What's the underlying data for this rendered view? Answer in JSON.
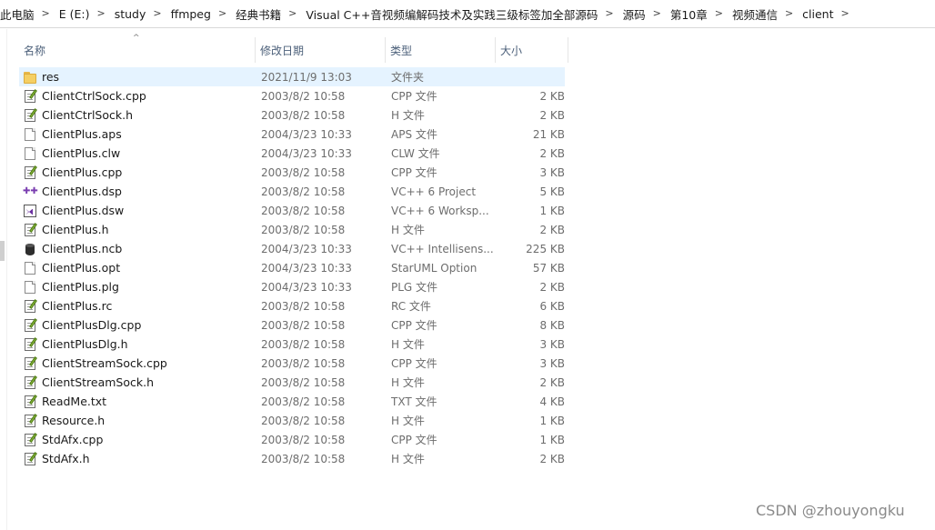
{
  "breadcrumb": [
    "此电脑",
    "E (E:)",
    "study",
    "ffmpeg",
    "经典书籍",
    "Visual C++音视频编解码技术及实践三级标签加全部源码",
    "源码",
    "第10章",
    "视频通信",
    "client"
  ],
  "breadcrumb_separator": ">",
  "columns": {
    "name": "名称",
    "date": "修改日期",
    "type": "类型",
    "size": "大小"
  },
  "sort_indicator": "^",
  "files": [
    {
      "name": "res",
      "date": "2021/11/9 13:03",
      "type": "文件夹",
      "size": "",
      "icon": "folder-icon"
    },
    {
      "name": "ClientCtrlSock.cpp",
      "date": "2003/8/2 10:58",
      "type": "CPP 文件",
      "size": "2 KB",
      "icon": "source-file-icon"
    },
    {
      "name": "ClientCtrlSock.h",
      "date": "2003/8/2 10:58",
      "type": "H 文件",
      "size": "2 KB",
      "icon": "source-file-icon"
    },
    {
      "name": "ClientPlus.aps",
      "date": "2004/3/23 10:33",
      "type": "APS 文件",
      "size": "21 KB",
      "icon": "blank-file-icon"
    },
    {
      "name": "ClientPlus.clw",
      "date": "2004/3/23 10:33",
      "type": "CLW 文件",
      "size": "2 KB",
      "icon": "blank-file-icon"
    },
    {
      "name": "ClientPlus.cpp",
      "date": "2003/8/2 10:58",
      "type": "CPP 文件",
      "size": "3 KB",
      "icon": "source-file-icon"
    },
    {
      "name": "ClientPlus.dsp",
      "date": "2003/8/2 10:58",
      "type": "VC++ 6 Project",
      "size": "5 KB",
      "icon": "vc-project-icon"
    },
    {
      "name": "ClientPlus.dsw",
      "date": "2003/8/2 10:58",
      "type": "VC++ 6 Worksp...",
      "size": "1 KB",
      "icon": "vc-workspace-icon"
    },
    {
      "name": "ClientPlus.h",
      "date": "2003/8/2 10:58",
      "type": "H 文件",
      "size": "2 KB",
      "icon": "source-file-icon"
    },
    {
      "name": "ClientPlus.ncb",
      "date": "2004/3/23 10:33",
      "type": "VC++ Intellisens...",
      "size": "225 KB",
      "icon": "database-icon"
    },
    {
      "name": "ClientPlus.opt",
      "date": "2004/3/23 10:33",
      "type": "StarUML Option",
      "size": "57 KB",
      "icon": "blank-file-icon"
    },
    {
      "name": "ClientPlus.plg",
      "date": "2004/3/23 10:33",
      "type": "PLG 文件",
      "size": "2 KB",
      "icon": "blank-file-icon"
    },
    {
      "name": "ClientPlus.rc",
      "date": "2003/8/2 10:58",
      "type": "RC 文件",
      "size": "6 KB",
      "icon": "source-file-icon"
    },
    {
      "name": "ClientPlusDlg.cpp",
      "date": "2003/8/2 10:58",
      "type": "CPP 文件",
      "size": "8 KB",
      "icon": "source-file-icon"
    },
    {
      "name": "ClientPlusDlg.h",
      "date": "2003/8/2 10:58",
      "type": "H 文件",
      "size": "3 KB",
      "icon": "source-file-icon"
    },
    {
      "name": "ClientStreamSock.cpp",
      "date": "2003/8/2 10:58",
      "type": "CPP 文件",
      "size": "3 KB",
      "icon": "source-file-icon"
    },
    {
      "name": "ClientStreamSock.h",
      "date": "2003/8/2 10:58",
      "type": "H 文件",
      "size": "2 KB",
      "icon": "source-file-icon"
    },
    {
      "name": "ReadMe.txt",
      "date": "2003/8/2 10:58",
      "type": "TXT 文件",
      "size": "4 KB",
      "icon": "source-file-icon"
    },
    {
      "name": "Resource.h",
      "date": "2003/8/2 10:58",
      "type": "H 文件",
      "size": "1 KB",
      "icon": "source-file-icon"
    },
    {
      "name": "StdAfx.cpp",
      "date": "2003/8/2 10:58",
      "type": "CPP 文件",
      "size": "1 KB",
      "icon": "source-file-icon"
    },
    {
      "name": "StdAfx.h",
      "date": "2003/8/2 10:58",
      "type": "H 文件",
      "size": "2 KB",
      "icon": "source-file-icon"
    }
  ],
  "watermark": "CSDN @zhouyongku",
  "colors": {
    "selection": "#e5f3ff",
    "header_text": "#4c607a",
    "meta_text": "#6d6d6d"
  }
}
